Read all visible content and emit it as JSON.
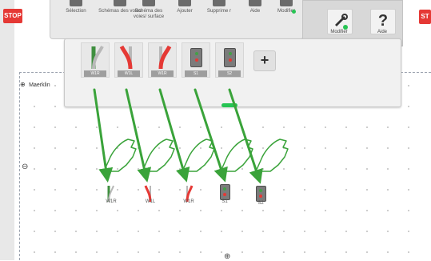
{
  "app": {
    "layout_name": "Maerklin"
  },
  "stop_buttons": {
    "left": "STOP",
    "right": "ST"
  },
  "toolbar": {
    "items": [
      {
        "label": "Sélection"
      },
      {
        "label": "Schémas des voies"
      },
      {
        "label": "Schéma des voies/ surface"
      },
      {
        "label": "Ajouter"
      },
      {
        "label": "Supprime r"
      },
      {
        "label": "Aide"
      },
      {
        "label": "Modifier"
      }
    ]
  },
  "right_panel": {
    "edit_label": "Modifier",
    "help_label": "Aide",
    "help_glyph": "?"
  },
  "palette": {
    "items": [
      {
        "label": "W1R",
        "type": "turnout-right",
        "color": "#3f8f3f"
      },
      {
        "label": "W1L",
        "type": "turnout-left",
        "color": "#e53935"
      },
      {
        "label": "W1R",
        "type": "turnout-right",
        "color": "#e53935"
      },
      {
        "label": "S1",
        "type": "signal"
      },
      {
        "label": "S2",
        "type": "signal"
      }
    ],
    "add_symbol": "+"
  },
  "placed_items": [
    {
      "label": "W1R",
      "type": "turnout-right",
      "color": "#3f8f3f"
    },
    {
      "label": "W1L",
      "type": "turnout-left",
      "color": "#e53935"
    },
    {
      "label": "W1R",
      "type": "turnout-right",
      "color": "#e53935"
    },
    {
      "label": "S1",
      "type": "signal"
    },
    {
      "label": "S2",
      "type": "signal"
    }
  ],
  "canvas_markers": {
    "left_marker": "⊖",
    "bottom_marker": "⊕"
  },
  "colors": {
    "stop_red": "#e53935",
    "drag_arrow_green": "#3aa33a",
    "turnout_red": "#e53935",
    "turnout_green": "#3f8f3f",
    "active_indicator": "#26c453"
  }
}
